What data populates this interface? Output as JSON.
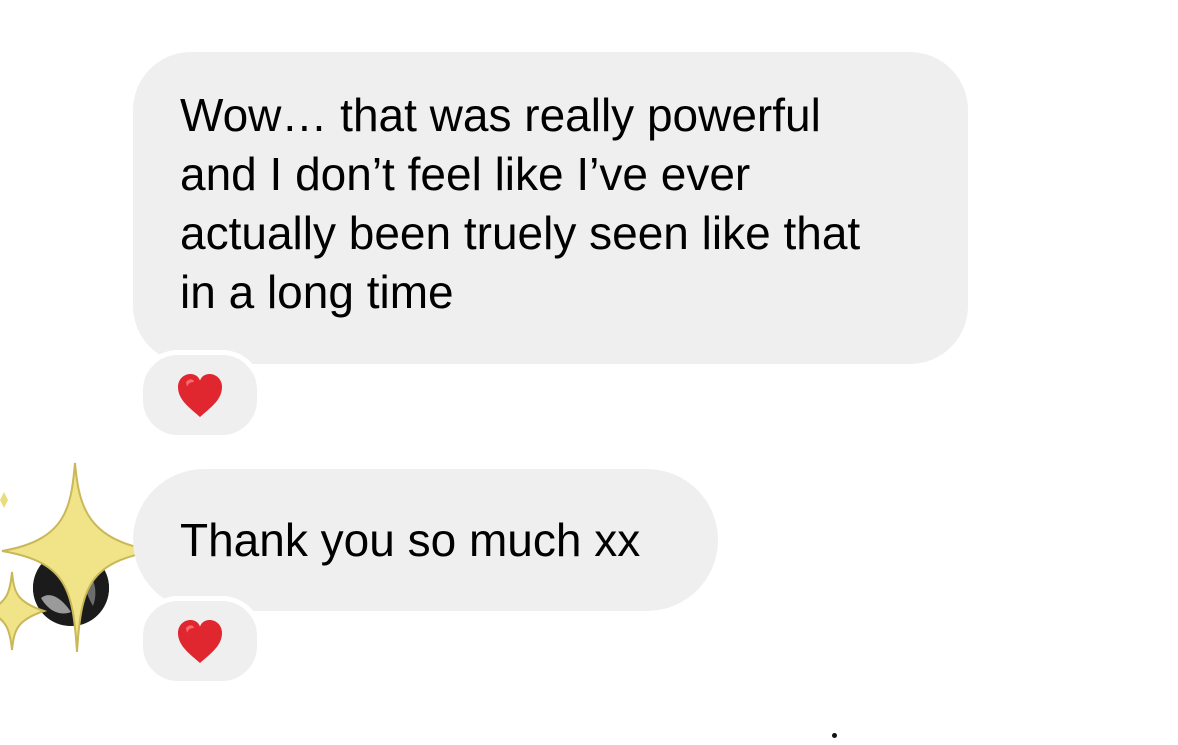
{
  "messages": [
    {
      "sender": "them",
      "lines": [
        "Wow… that was really powerful",
        "and I don’t feel like I’ve ever",
        "actually been truely seen like that",
        "in a long time"
      ],
      "reaction": "red-heart"
    },
    {
      "sender": "them",
      "lines": [
        "Thank you so much xx"
      ],
      "reaction": "red-heart"
    }
  ],
  "avatar": {
    "icon": "sparkles-icon"
  },
  "colors": {
    "bubble": "#efefef",
    "heart": "#e0262f",
    "sparkle": "#f1e488"
  }
}
